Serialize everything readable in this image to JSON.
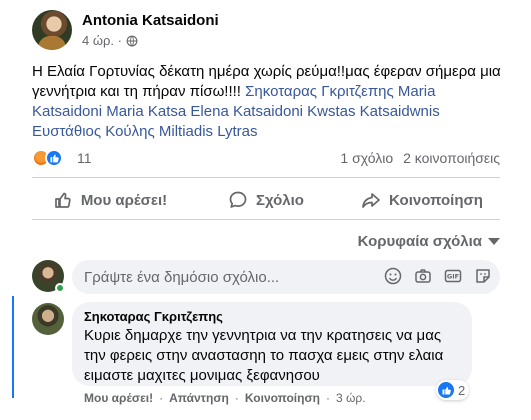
{
  "post": {
    "author": "Antonia Katsaidoni",
    "time": "4 ώρ. ·",
    "privacy_icon": "globe-icon",
    "text": "Η Ελαία Γορτυνίας δέκατη ημέρα χωρίς ρεύμα!!μας έφεραν σήμερα μια γεννήτρια και τη πήραν πίσω!!!! ",
    "tags": "Σηκοταρας Γκριτζεπης Maria Katsaidoni Maria Katsa Elena Katsaidoni Kwstas Katsaidwnis Ευστάθιος Κούλης Miltiadis Lytras"
  },
  "stats": {
    "reaction_count": "11",
    "comments": "1 σχόλιο",
    "shares": "2 κοινοποιήσεις"
  },
  "actions": {
    "like": "Μου αρέσει!",
    "comment": "Σχόλιο",
    "share": "Κοινοποίηση"
  },
  "sort": {
    "label": "Κορυφαία σχόλια"
  },
  "composer": {
    "placeholder": "Γράψτε ένα δημόσιο σχόλιο..."
  },
  "comment": {
    "author": "Σηκοταρας Γκριτζεπης",
    "text": "Κυριε δημαρχε την γεννητρια να την κρατησεις να μας την φερεις στην αναστασηη το πασχα εμεις στην ελαια ειμαστε μαχιτες μονιμας ξεφανησου",
    "like_count": "2",
    "like_label": "Μου αρέσει!",
    "reply_label": "Απάντηση",
    "share_label": "Κοινοποίηση",
    "time": "3 ώρ."
  },
  "colors": {
    "accent": "#1877f2",
    "link": "#385898",
    "muted": "#65676b",
    "bubble": "#f0f2f5"
  }
}
